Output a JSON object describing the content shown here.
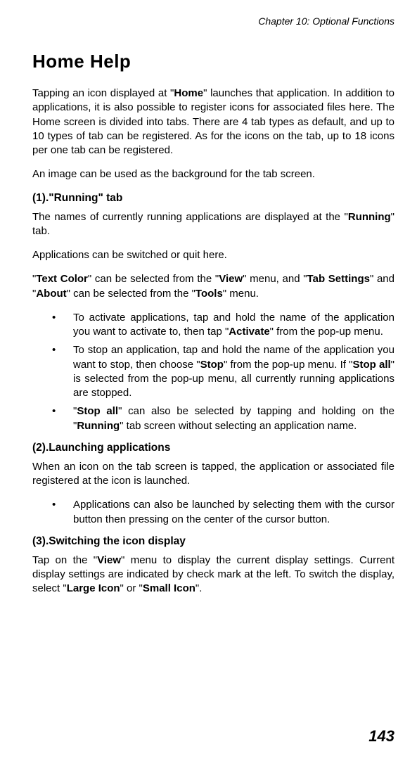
{
  "chapter": "Chapter 10: Optional Functions",
  "title": "Home Help",
  "p1_a": "Tapping an icon displayed at \"",
  "p1_b": "\" launches that application. In addition to applications, it is also possible to register icons for associated files here. The Home screen is divided into tabs. There are 4 tab types as default, and up to 10 types of tab can be registered. As for the icons on the tab, up to 18 icons per one tab can be registered.",
  "home_bold": "Home",
  "p2": "An image can be used as the background for the tab screen.",
  "s1": "(1).\"Running\" tab",
  "p3_a": "The names of currently running applications are displayed at the \"",
  "p3_b": "\" tab.",
  "running_bold": "Running",
  "p4": "Applications can be switched or quit here.",
  "p5_a": "\"",
  "textcolor_bold": "Text Color",
  "p5_b": "\" can be selected from the \"",
  "view_bold": "View",
  "p5_c": "\" menu, and \"",
  "tabsettings_bold": "Tab Settings",
  "p5_d": "\" and \"",
  "about_bold": "About",
  "p5_e": "\" can be selected from the \"",
  "tools_bold": "Tools",
  "p5_f": "\" menu.",
  "b1_a": "To activate applications, tap and hold the name of the application you want to activate to, then tap \"",
  "activate_bold": "Activate",
  "b1_b": "\" from the pop-up menu.",
  "b2_a": "To stop an application, tap and hold the name of the application you want to stop, then choose \"",
  "stop_bold": "Stop",
  "b2_b": "\" from the pop-up menu. If \"",
  "stopall_bold": "Stop all",
  "b2_c": "\" is selected from the pop-up menu, all currently running applications are stopped.",
  "b3_a": "\"",
  "stopall2_bold": "Stop all",
  "b3_b": "\" can also be selected by tapping and holding on the \"",
  "running2_bold": "Running",
  "b3_c": "\" tab screen without selecting an application name.",
  "s2": "(2).Launching applications",
  "p6": "When an icon on the tab screen is tapped, the application or associated file registered at the icon is launched.",
  "b4": "Applications can also be launched by selecting them with the cursor button then pressing on the center of the cursor button.",
  "s3": "(3).Switching the icon display",
  "p7_a": "Tap on the \"",
  "view2_bold": "View",
  "p7_b": "\" menu to display the current display settings. Current display settings are indicated by check mark at the left. To switch the display, select \"",
  "largeicon_bold": "Large Icon",
  "p7_c": "\" or \"",
  "smallicon_bold": "Small Icon",
  "p7_d": "\".",
  "pagenum": "143"
}
